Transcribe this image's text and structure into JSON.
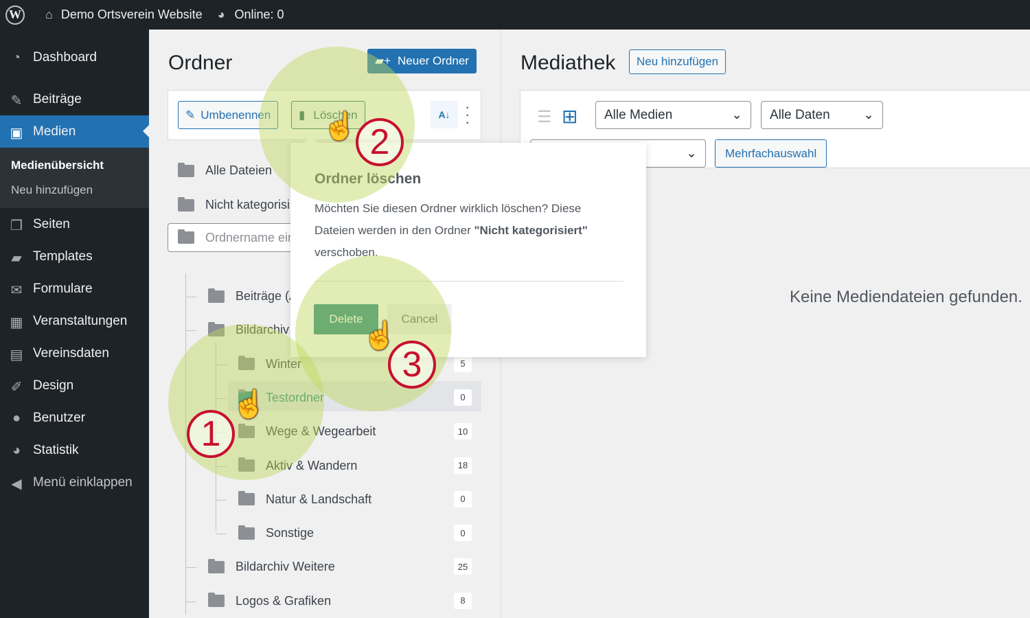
{
  "topbar": {
    "site": "Demo Ortsverein Website",
    "online": "Online: 0"
  },
  "sidebar": {
    "items": [
      {
        "label": "Dashboard",
        "icon": "dashboard-icon"
      },
      {
        "label": "Beiträge",
        "icon": "pin-icon"
      },
      {
        "label": "Medien",
        "icon": "media-icon"
      },
      {
        "label": "Seiten",
        "icon": "pages-icon"
      },
      {
        "label": "Templates",
        "icon": "folder-open-icon"
      },
      {
        "label": "Formulare",
        "icon": "mail-icon"
      },
      {
        "label": "Veranstaltungen",
        "icon": "calendar-icon"
      },
      {
        "label": "Vereinsdaten",
        "icon": "id-card-icon"
      },
      {
        "label": "Design",
        "icon": "brush-icon"
      },
      {
        "label": "Benutzer",
        "icon": "user-icon"
      },
      {
        "label": "Statistik",
        "icon": "pie-chart-icon"
      },
      {
        "label": "Menü einklappen",
        "icon": "collapse-icon"
      }
    ],
    "submenu": [
      "Medienübersicht",
      "Neu hinzufügen"
    ]
  },
  "folders": {
    "title": "Ordner",
    "new_folder": "Neuer Ordner",
    "rename": "Umbenennen",
    "delete": "Löschen",
    "all_files": "Alle Dateien",
    "uncategorized": "Nicht kategorisi",
    "search_placeholder": "Ordnername ein",
    "tree": [
      {
        "label": "Beiträge (A",
        "level": 0,
        "count": ""
      },
      {
        "label": "Bildarchiv",
        "level": 0,
        "count": "",
        "open": true
      },
      {
        "label": "Winter",
        "level": 1,
        "count": "5"
      },
      {
        "label": "Testordner",
        "level": 1,
        "count": "0",
        "selected": true
      },
      {
        "label": "Wege & Wegearbeit",
        "level": 1,
        "count": "10"
      },
      {
        "label": "Aktiv & Wandern",
        "level": 1,
        "count": "18"
      },
      {
        "label": "Natur & Landschaft",
        "level": 1,
        "count": "0"
      },
      {
        "label": "Sonstige",
        "level": 1,
        "count": "0"
      },
      {
        "label": "Bildarchiv Weitere",
        "level": 0,
        "count": "25"
      },
      {
        "label": "Logos & Grafiken",
        "level": 0,
        "count": "8"
      }
    ]
  },
  "popup": {
    "title": "Ordner löschen",
    "text1": "Möchten Sie diesen Ordner wirklich löschen? Diese",
    "text2a": "Dateien werden in den Ordner ",
    "text2b": "\"Nicht kategorisiert\"",
    "text3": "verschoben.",
    "delete": "Delete",
    "cancel": "Cancel"
  },
  "media": {
    "title": "Mediathek",
    "add_new": "Neu hinzufügen",
    "filter_type": "Alle Medien",
    "filter_date": "Alle Daten",
    "bulk": "Mehrfachauswahl",
    "empty": "Keine Mediendateien gefunden."
  },
  "annotations": [
    "1",
    "2",
    "3"
  ],
  "colors": {
    "accent": "#2271b1",
    "selected": "#2a8a84",
    "marker": "#c8102e",
    "highlight": "#bed75a"
  }
}
